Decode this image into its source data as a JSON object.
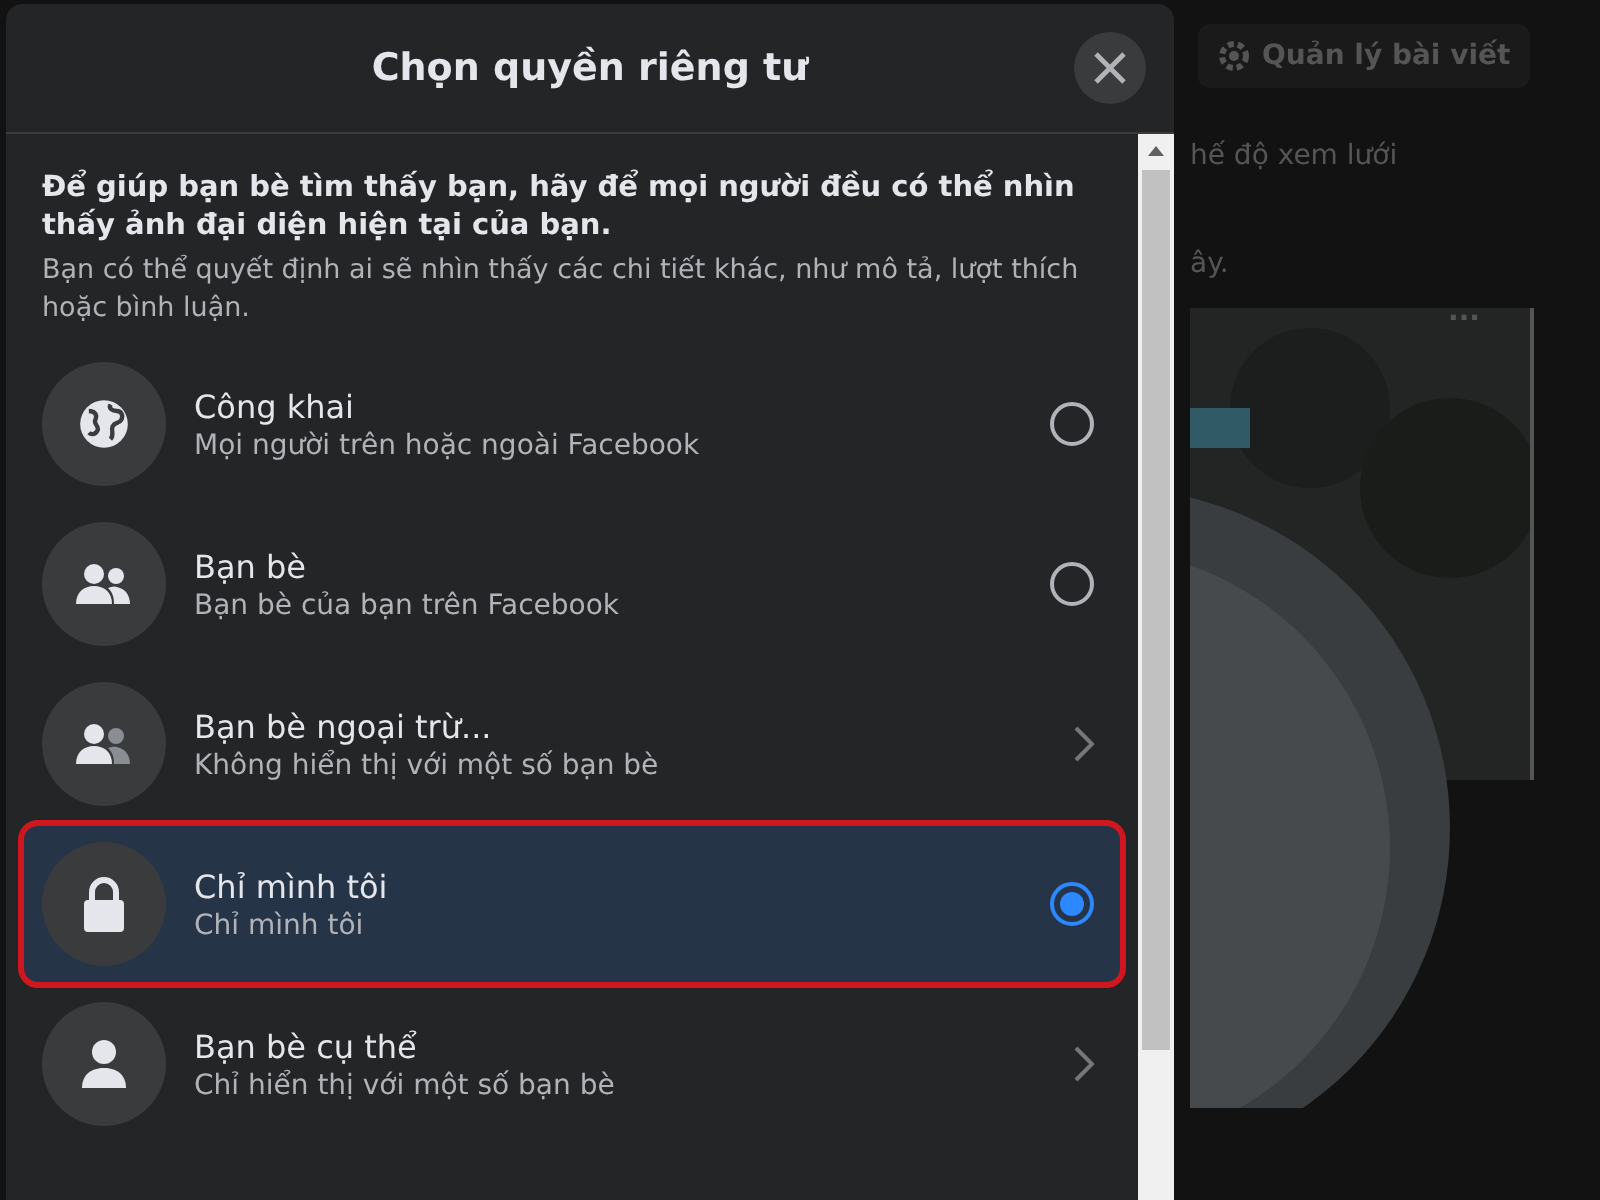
{
  "dialog": {
    "title": "Chọn quyền riêng tư",
    "intro": "Để giúp bạn bè tìm thấy bạn, hãy để mọi người đều có thể nhìn thấy ảnh đại diện hiện tại của bạn.",
    "note": "Bạn có thể quyết định ai sẽ nhìn thấy các chi tiết khác, như mô tả, lượt thích hoặc bình luận.",
    "options": [
      {
        "title": "Công khai",
        "subtitle": "Mọi người trên hoặc ngoài Facebook",
        "kind": "radio",
        "selected": false,
        "highlighted": false
      },
      {
        "title": "Bạn bè",
        "subtitle": "Bạn bè của bạn trên Facebook",
        "kind": "radio",
        "selected": false,
        "highlighted": false
      },
      {
        "title": "Bạn bè ngoại trừ...",
        "subtitle": "Không hiển thị với một số bạn bè",
        "kind": "chevron",
        "selected": false,
        "highlighted": false
      },
      {
        "title": "Chỉ mình tôi",
        "subtitle": "Chỉ mình tôi",
        "kind": "radio",
        "selected": true,
        "highlighted": true
      },
      {
        "title": "Bạn bè cụ thể",
        "subtitle": "Chỉ hiển thị với một số bạn bè",
        "kind": "chevron",
        "selected": false,
        "highlighted": false
      }
    ]
  },
  "background": {
    "manage_button": "Quản lý bài viết",
    "grid_view": "hế độ xem lưới",
    "text_fragment": "ây.",
    "more": "..."
  }
}
